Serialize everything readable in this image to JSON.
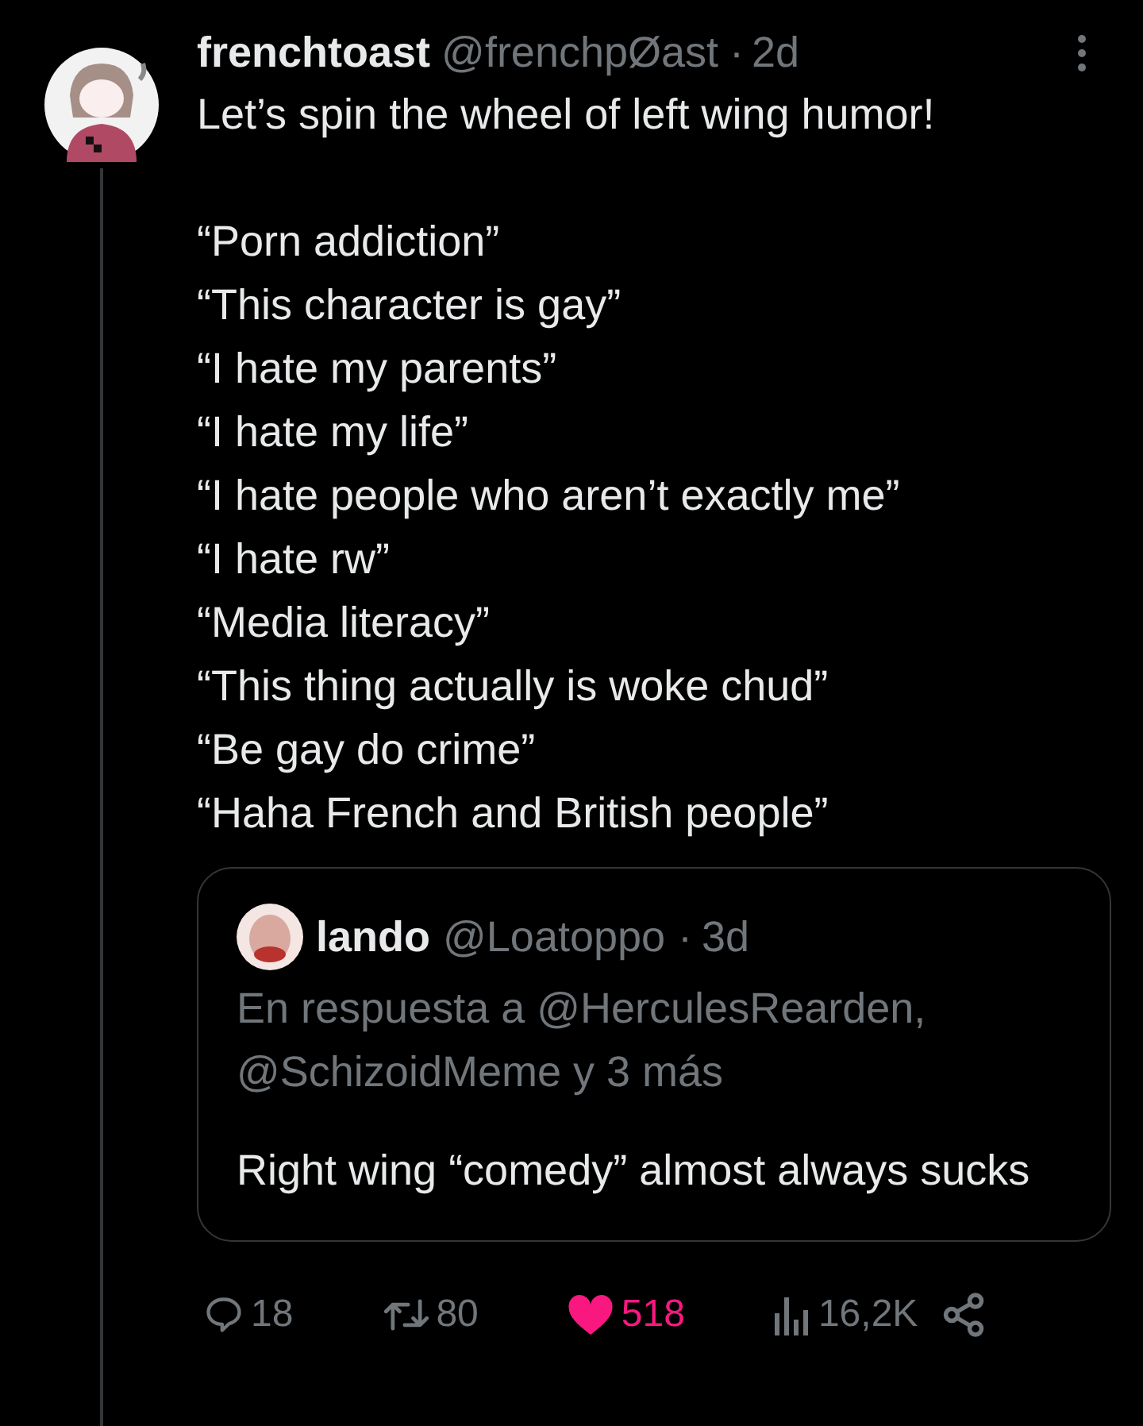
{
  "post": {
    "author": {
      "name": "frenchtoast",
      "handle": "@frenchpØast",
      "separator": "·",
      "time": "2d"
    },
    "intro": "Let’s spin the wheel of left wing humor!",
    "lines": [
      "“Porn addiction”",
      "“This character is gay”",
      "“I hate my parents”",
      "“I hate my life”",
      "“I hate people who aren’t exactly me”",
      "“I hate rw”",
      "“Media literacy”",
      "“This thing actually is woke chud”",
      "“Be gay do crime”",
      "“Haha French and British people”"
    ],
    "quote": {
      "author": {
        "name": "lando",
        "handle": "@Loatoppo",
        "separator": "·",
        "time": "3d"
      },
      "reply_to": "En respuesta a @HerculesRearden, @SchizoidMeme y 3 más",
      "text": "Right wing “comedy” almost always sucks"
    },
    "actions": [
      {
        "kind": "reply",
        "count": "18",
        "active": false
      },
      {
        "kind": "repost",
        "count": "80",
        "active": false
      },
      {
        "kind": "like",
        "count": "518",
        "active": true
      },
      {
        "kind": "views",
        "count": "16,2K",
        "active": false
      },
      {
        "kind": "share",
        "active": false
      }
    ]
  }
}
